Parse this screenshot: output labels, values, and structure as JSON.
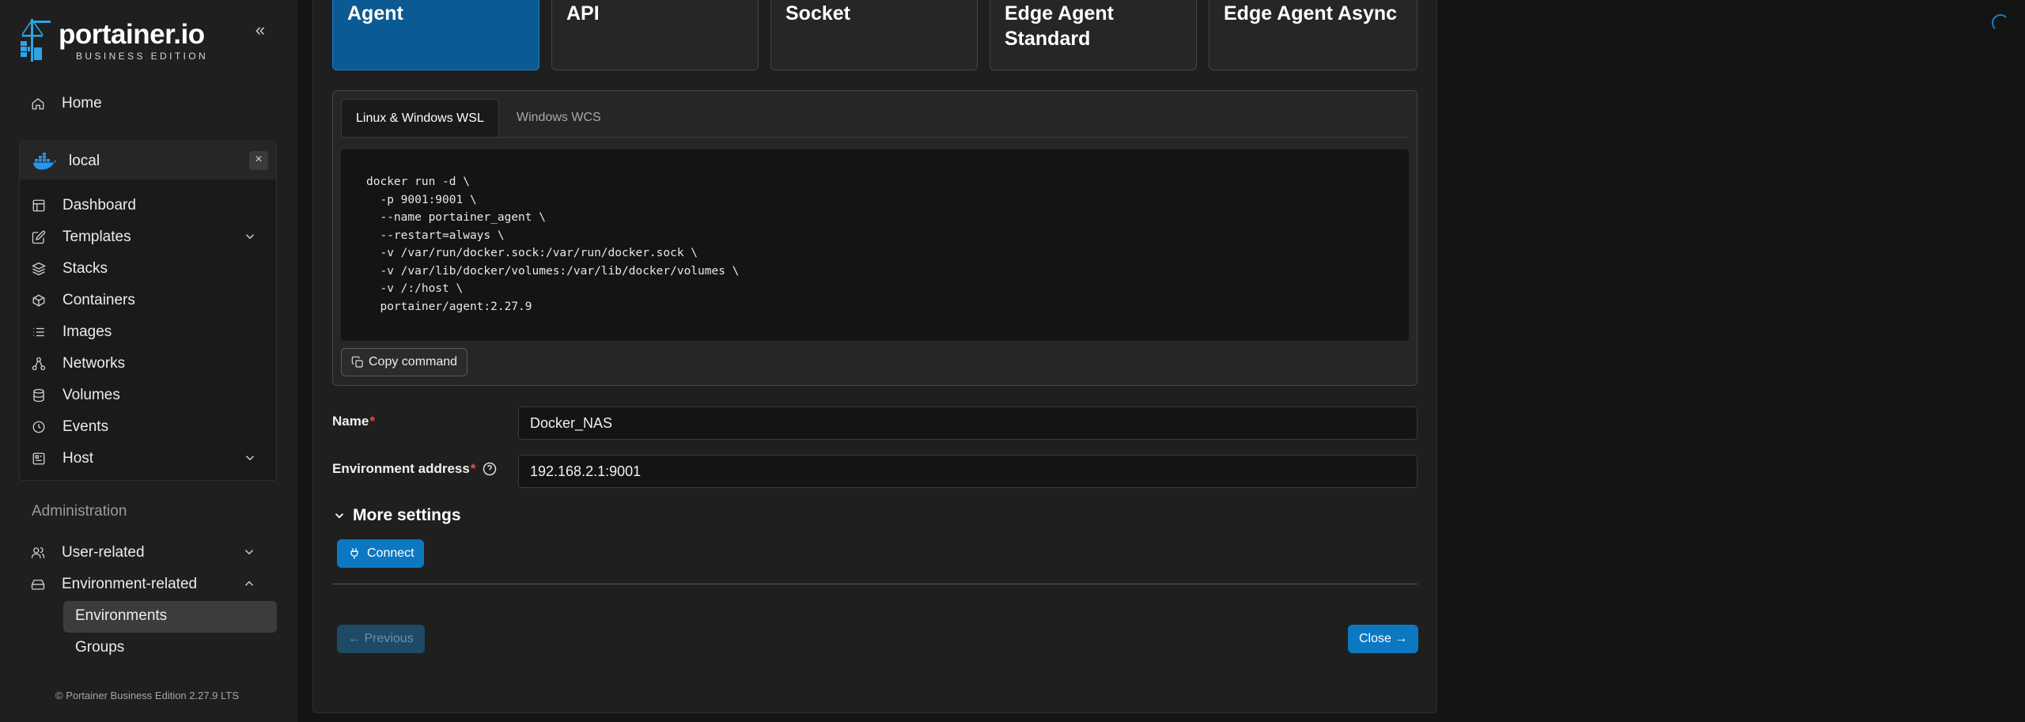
{
  "sidebar": {
    "logo_name": "portainer.io",
    "logo_edition": "BUSINESS EDITION",
    "collapse_glyph": "«",
    "home_label": "Home",
    "environment": {
      "name": "local",
      "close_glyph": "×",
      "items": [
        {
          "label": "Dashboard",
          "icon": "dashboard-icon"
        },
        {
          "label": "Templates",
          "icon": "edit-icon",
          "expandable": true
        },
        {
          "label": "Stacks",
          "icon": "layers-icon"
        },
        {
          "label": "Containers",
          "icon": "box-icon"
        },
        {
          "label": "Images",
          "icon": "list-icon"
        },
        {
          "label": "Networks",
          "icon": "network-icon"
        },
        {
          "label": "Volumes",
          "icon": "database-icon"
        },
        {
          "label": "Events",
          "icon": "clock-icon"
        },
        {
          "label": "Host",
          "icon": "host-icon",
          "expandable": true
        }
      ]
    },
    "admin_label": "Administration",
    "admin_items": [
      {
        "label": "User-related",
        "icon": "users-icon",
        "expanded": false
      },
      {
        "label": "Environment-related",
        "icon": "hdd-icon",
        "expanded": true
      }
    ],
    "env_related_sub": [
      "Environments",
      "Groups"
    ],
    "active_sub": "Environments",
    "footer": "© Portainer Business Edition 2.27.9 LTS"
  },
  "env_types": [
    "Agent",
    "API",
    "Socket",
    "Edge Agent Standard",
    "Edge Agent Async"
  ],
  "selected_type": "Agent",
  "tabs": [
    "Linux & Windows WSL",
    "Windows WCS"
  ],
  "active_tab": "Linux & Windows WSL",
  "command": "docker run -d \\\n  -p 9001:9001 \\\n  --name portainer_agent \\\n  --restart=always \\\n  -v /var/run/docker.sock:/var/run/docker.sock \\\n  -v /var/lib/docker/volumes:/var/lib/docker/volumes \\\n  -v /:/host \\\n  portainer/agent:2.27.9",
  "copy_label": "Copy command",
  "form": {
    "name_label": "Name",
    "name_value": "Docker_NAS",
    "address_label": "Environment address",
    "address_value": "192.168.2.1:9001",
    "required_mark": "*"
  },
  "more_settings_label": "More settings",
  "connect_label": "Connect",
  "previous_label": "← Previous",
  "close_label": "Close →",
  "colors": {
    "accent": "#0d78c2",
    "selected_card": "#0b5a93",
    "required": "#e05252"
  }
}
